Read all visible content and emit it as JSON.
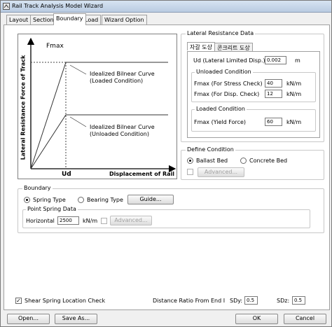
{
  "window": {
    "title": "Rail Track Analysis Model Wizard"
  },
  "tabs": [
    {
      "label": "Layout"
    },
    {
      "label": "Section"
    },
    {
      "label": "Boundary"
    },
    {
      "label": "Load"
    },
    {
      "label": "Wizard Option"
    }
  ],
  "diagram": {
    "fmax_label": "Fmax",
    "y_axis_label": "Lateral Resistance Force of Track",
    "x_axis_label": "Displacement of Rail",
    "ud_label": "Ud",
    "loaded_curve_label_1": "Idealized Bilnear Curve",
    "loaded_curve_label_2": "(Loaded Condition)",
    "unloaded_curve_label_1": "Idealized Bilnear Curve",
    "unloaded_curve_label_2": "(Unloaded Condition)"
  },
  "lateral_resistance": {
    "group_title": "Lateral Resistance Data",
    "subtabs": [
      {
        "label": "자갈 도상"
      },
      {
        "label": "콘크리트 도상"
      }
    ],
    "ud_label": "Ud (Lateral Limited Disp.)",
    "ud_value": "0.002",
    "ud_unit": "m",
    "unloaded": {
      "title": "Unloaded Condition",
      "stress_label": "Fmax (For Stress Check)",
      "stress_value": "40",
      "stress_unit": "kN/m",
      "disp_label": "Fmax (For Disp. Check)",
      "disp_value": "12",
      "disp_unit": "kN/m"
    },
    "loaded": {
      "title": "Loaded Condition",
      "yield_label": "Fmax (Yield Force)",
      "yield_value": "60",
      "yield_unit": "kN/m"
    }
  },
  "define_condition": {
    "title": "Define Condition",
    "ballast_label": "Ballast Bed",
    "concrete_label": "Concrete Bed",
    "advanced_label": "Advanced..."
  },
  "boundary": {
    "title": "Boundary",
    "spring_label": "Spring Type",
    "bearing_label": "Bearing Type",
    "guide_label": "Guide...",
    "point_spring": {
      "title": "Point Spring Data",
      "horizontal_label": "Horizontal",
      "horizontal_value": "2500",
      "horizontal_unit": "kN/m",
      "advanced_label": "Advanced..."
    }
  },
  "shear_spring": {
    "check_label": "Shear Spring Location Check",
    "distance_label": "Distance Ratio From End I",
    "sdy_label": "SDy:",
    "sdy_value": "0.5",
    "sdz_label": "SDz:",
    "sdz_value": "0.5"
  },
  "footer": {
    "open_label": "Open...",
    "save_label": "Save As...",
    "ok_label": "OK",
    "cancel_label": "Cancel"
  },
  "colors": {
    "title_gradient_top": "#d7e4f2",
    "title_gradient_bottom": "#b9cbe2",
    "curve": "#333333"
  }
}
